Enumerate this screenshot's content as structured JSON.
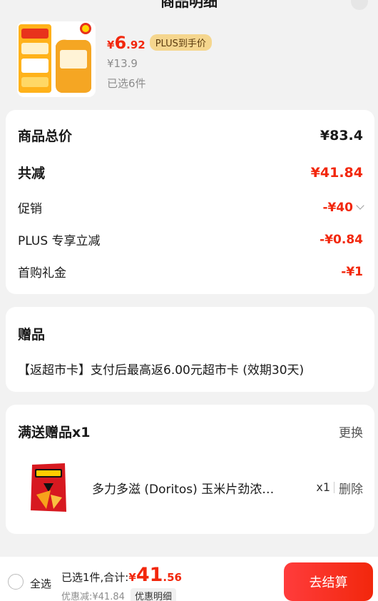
{
  "header": {
    "title": "商品明细"
  },
  "product": {
    "currency": "¥",
    "price_int": "6",
    "price_dec": ".92",
    "plus_tag": "PLUS到手价",
    "original_price": "¥13.9",
    "selected_count": "已选6件"
  },
  "summary": {
    "total_label": "商品总价",
    "total_value": "¥83.4",
    "reduce_label": "共减",
    "reduce_value": "¥41.84",
    "promo_label": "促销",
    "promo_value": "-¥40",
    "plus_label": "PLUS 专享立减",
    "plus_value": "-¥0.84",
    "first_label": "首购礼金",
    "first_value": "-¥1"
  },
  "gift": {
    "title": "赠品",
    "text": "【返超市卡】支付后最高返6.00元超市卡 (效期30天)"
  },
  "free_gift": {
    "title": "满送赠品x1",
    "change": "更换",
    "item_name": "多力多滋 (Doritos) 玉米片劲浓…",
    "qty": "x1",
    "delete": "删除"
  },
  "footer": {
    "select_all": "全选",
    "summary_text": "已选1件,合计:",
    "currency": "¥",
    "total_int": "41",
    "total_dec": ".56",
    "discount_text": "优惠减:¥41.84",
    "detail_button": "优惠明细",
    "checkout": "去结算"
  },
  "colors": {
    "accent": "#f2270c",
    "plus_tag": "#f5d68e"
  }
}
